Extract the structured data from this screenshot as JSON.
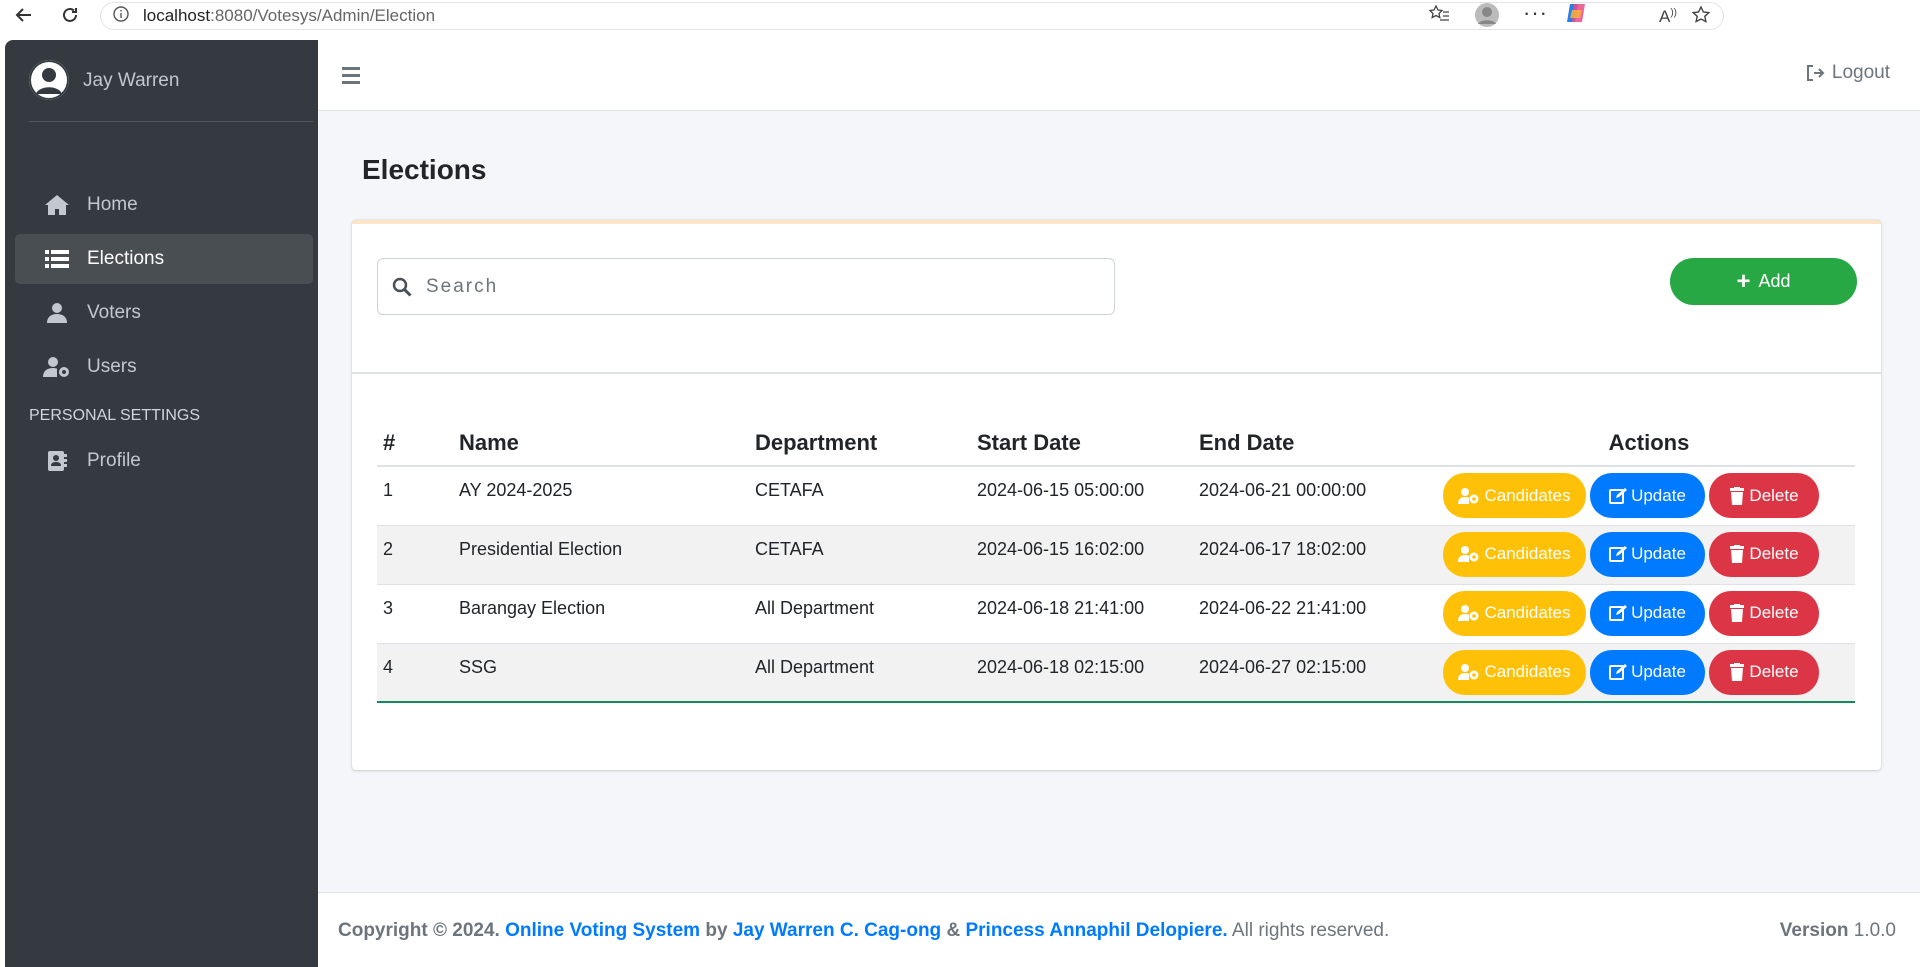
{
  "browser": {
    "url_host": "localhost",
    "url_rest": ":8080/Votesys/Admin/Election"
  },
  "sidebar": {
    "user_name": "Jay Warren",
    "items": [
      {
        "label": "Home",
        "icon": "home-icon"
      },
      {
        "label": "Elections",
        "icon": "list-icon",
        "active": true
      },
      {
        "label": "Voters",
        "icon": "user-icon"
      },
      {
        "label": "Users",
        "icon": "user-cog-icon"
      }
    ],
    "section_header": "PERSONAL SETTINGS",
    "settings_items": [
      {
        "label": "Profile",
        "icon": "address-card-icon"
      }
    ]
  },
  "topbar": {
    "logout_label": "Logout"
  },
  "page": {
    "title": "Elections"
  },
  "search": {
    "placeholder": "Search",
    "value": ""
  },
  "toolbar": {
    "add_label": "Add"
  },
  "table": {
    "headers": [
      "#",
      "Name",
      "Department",
      "Start Date",
      "End Date",
      "Actions"
    ],
    "rows": [
      {
        "num": "1",
        "name": "AY 2024-2025",
        "department": "CETAFA",
        "start": "2024-06-15 05:00:00",
        "end": "2024-06-21 00:00:00"
      },
      {
        "num": "2",
        "name": "Presidential Election",
        "department": "CETAFA",
        "start": "2024-06-15 16:02:00",
        "end": "2024-06-17 18:02:00"
      },
      {
        "num": "3",
        "name": "Barangay Election",
        "department": "All Department",
        "start": "2024-06-18 21:41:00",
        "end": "2024-06-22 21:41:00"
      },
      {
        "num": "4",
        "name": "SSG",
        "department": "All Department",
        "start": "2024-06-18 02:15:00",
        "end": "2024-06-27 02:15:00"
      }
    ],
    "actions": {
      "candidates_label": "Candidates",
      "update_label": "Update",
      "delete_label": "Delete"
    }
  },
  "footer": {
    "copyright": "Copyright © 2024.",
    "system_name": "Online Voting System",
    "by": "by",
    "author1": "Jay Warren C. Cag-ong",
    "amp": "&",
    "author2": "Princess Annaphil Delopiere.",
    "rights": "All rights reserved.",
    "version_label": "Version",
    "version_value": "1.0.0"
  },
  "colors": {
    "sidebar_bg": "#343a40",
    "success": "#28a745",
    "warning": "#ffc107",
    "primary": "#007bff",
    "danger": "#dc3545"
  }
}
